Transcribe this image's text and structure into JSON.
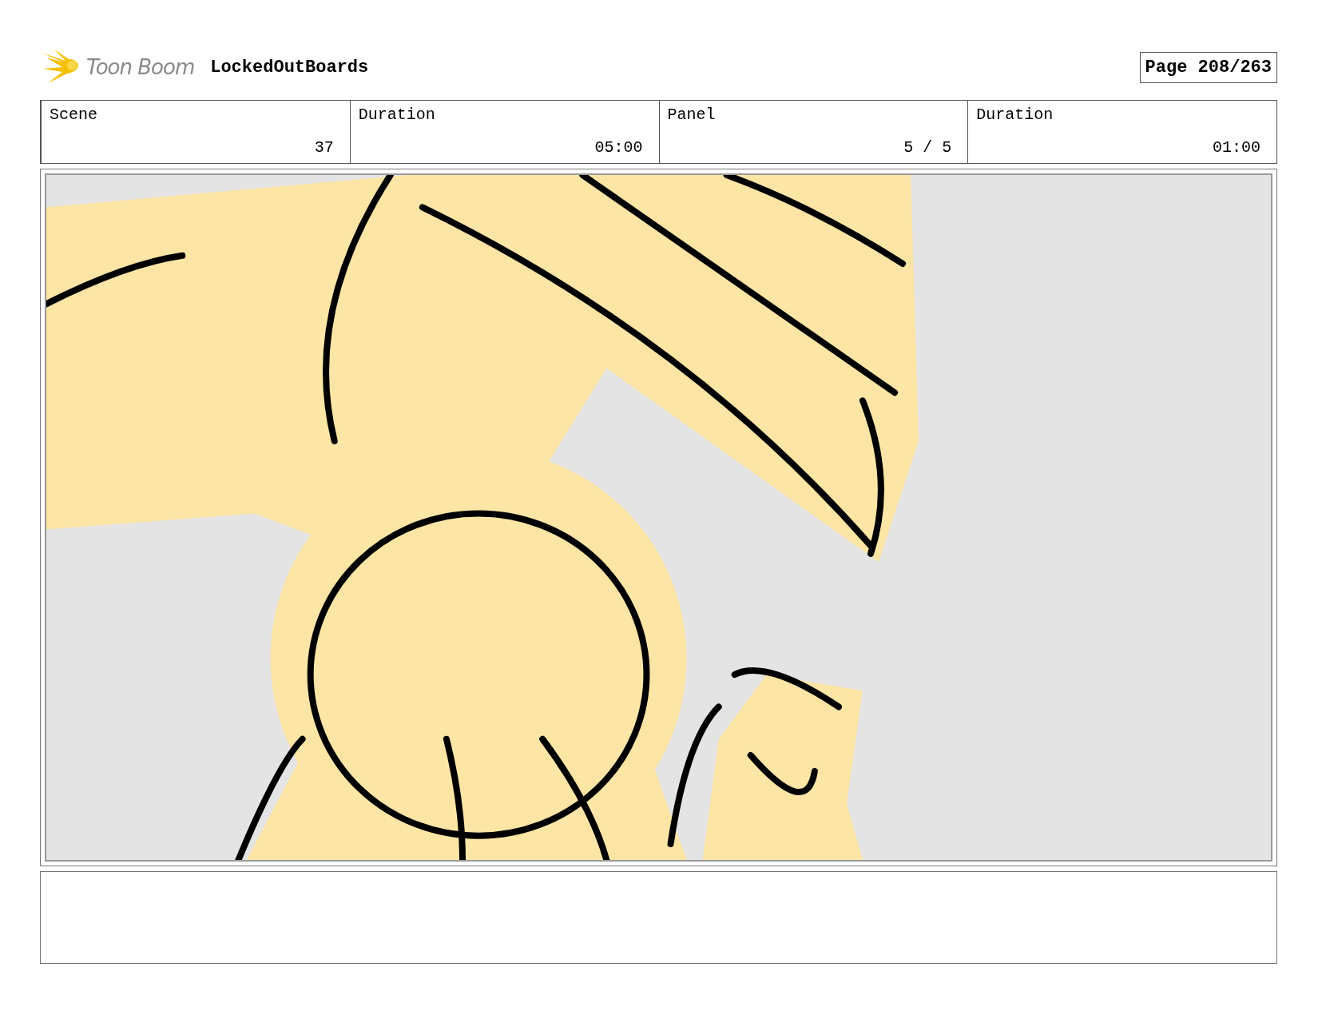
{
  "header": {
    "logo_text": "Toon Boom",
    "project": "LockedOutBoards",
    "page": "Page 208/263"
  },
  "fields": [
    {
      "label": "Scene",
      "value": "37"
    },
    {
      "label": "Duration",
      "value": "05:00"
    },
    {
      "label": "Panel",
      "value": "5 / 5"
    },
    {
      "label": "Duration",
      "value": "01:00"
    }
  ]
}
